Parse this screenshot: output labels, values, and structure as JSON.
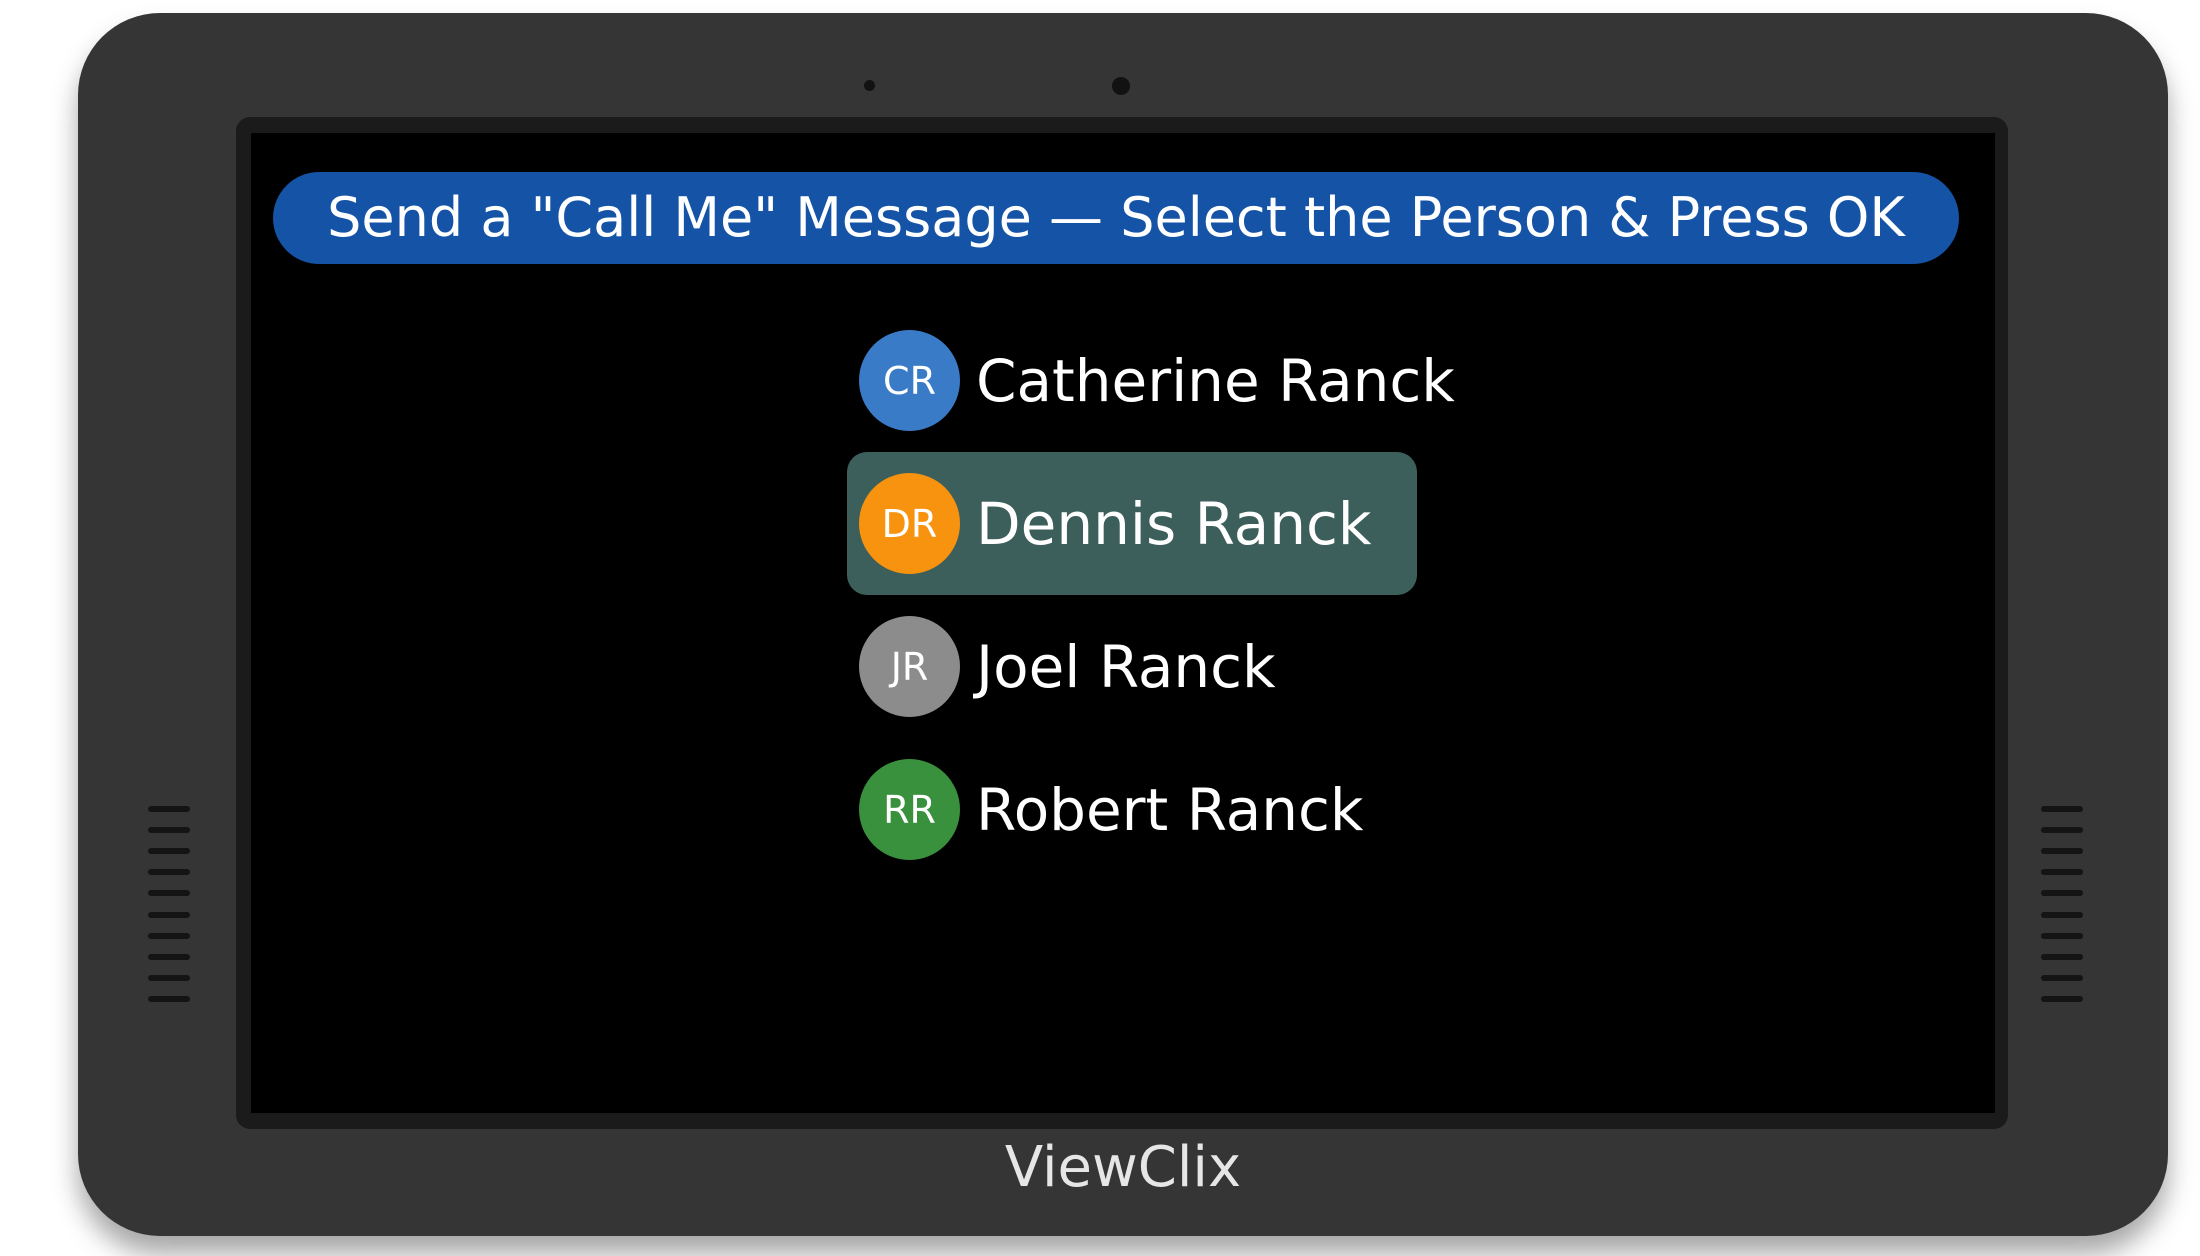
{
  "banner": {
    "text": "Send a \"Call Me\" Message — Select the Person & Press OK"
  },
  "contacts": [
    {
      "initials": "CR",
      "name": "Catherine Ranck",
      "color": "#3a7bc8",
      "selected": false
    },
    {
      "initials": "DR",
      "name": "Dennis Ranck",
      "color": "#f7930e",
      "selected": true
    },
    {
      "initials": "JR",
      "name": "Joel Ranck",
      "color": "#8c8c8c",
      "selected": false
    },
    {
      "initials": "RR",
      "name": "Robert Ranck",
      "color": "#3a913d",
      "selected": false
    }
  ],
  "device": {
    "brand": "ViewClix"
  },
  "colors": {
    "banner": "#1453a6",
    "selected_row": "#3d5f5b",
    "bezel": "#353535",
    "screen": "#000000"
  }
}
